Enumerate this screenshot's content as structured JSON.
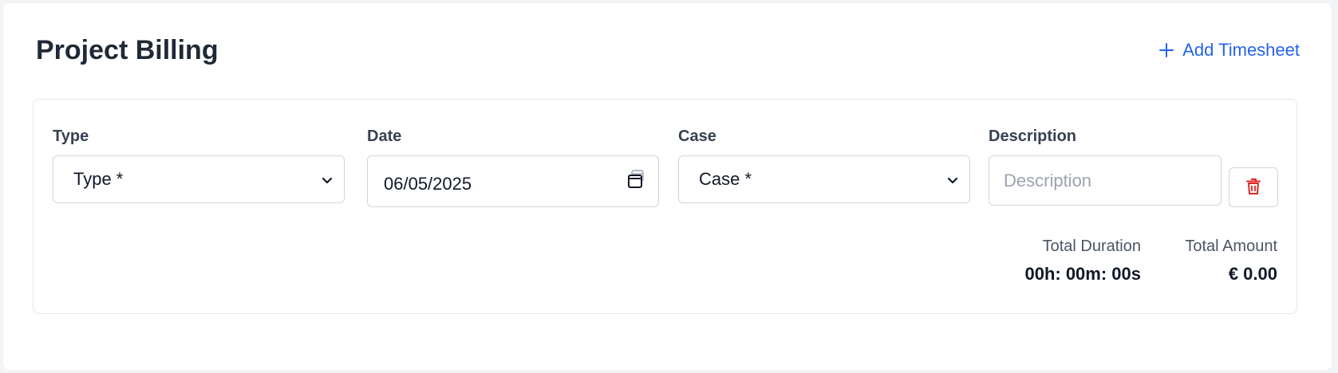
{
  "header": {
    "title": "Project Billing",
    "add_label": "Add Timesheet",
    "add_icon": "plus-icon"
  },
  "row": {
    "type": {
      "label": "Type",
      "value": "Type *"
    },
    "date": {
      "label": "Date",
      "value": "06/05/2025"
    },
    "case": {
      "label": "Case",
      "value": "Case *"
    },
    "description": {
      "label": "Description",
      "placeholder": "Description"
    },
    "delete_icon": "trash-icon"
  },
  "totals": {
    "duration_label": "Total Duration",
    "duration_value": "00h: 00m: 00s",
    "amount_label": "Total Amount",
    "amount_value": "€ 0.00"
  },
  "colors": {
    "accent": "#2563eb",
    "danger": "#dc2626",
    "border": "#d1d5db",
    "title": "#1f2937"
  }
}
